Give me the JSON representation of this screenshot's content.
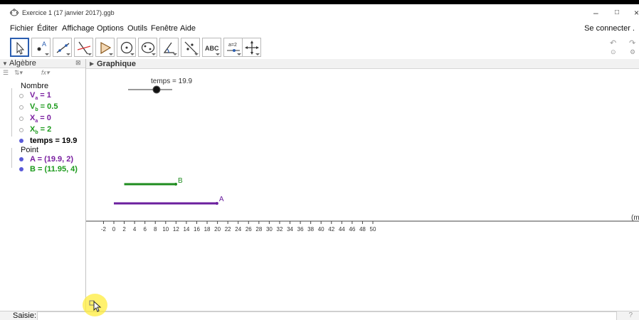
{
  "window": {
    "title": "Exercice 1 (17 janvier 2017).ggb",
    "minimize": "–",
    "maximize": "□",
    "close": "×"
  },
  "menu": {
    "items": [
      "Fichier",
      "Éditer",
      "Affichage",
      "Options",
      "Outils",
      "Fenêtre",
      "Aide"
    ],
    "connect": "Se connecter ."
  },
  "toolbar": {
    "tools": [
      "move-tool",
      "point-tool",
      "line-tool",
      "perpendicular-tool",
      "polygon-tool",
      "circle-tool",
      "conic-tool",
      "angle-tool",
      "reflect-tool",
      "text-tool",
      "slider-tool",
      "move-graphics-tool"
    ],
    "text_tool_label": "ABC",
    "slider_tool_label": "a=2",
    "undo": "↶",
    "redo": "↷"
  },
  "algebra": {
    "header": "Algèbre",
    "close": "⊠",
    "categories": {
      "number": "Nombre",
      "point": "Point"
    },
    "items": [
      {
        "name": "V",
        "sub": "a",
        "rest": " = 1",
        "color": "purple"
      },
      {
        "name": "V",
        "sub": "b",
        "rest": " = 0.5",
        "color": "green"
      },
      {
        "name": "X",
        "sub": "a",
        "rest": " = 0",
        "color": "purple"
      },
      {
        "name": "X",
        "sub": "b",
        "rest": " = 2",
        "color": "green"
      },
      {
        "text": "temps = 19.9",
        "color": "black"
      }
    ],
    "points": [
      {
        "text": "A = (19.9, 2)",
        "color": "purple"
      },
      {
        "text": "B = (11.95, 4)",
        "color": "green"
      }
    ]
  },
  "graphics": {
    "header": "Graphique",
    "slider": {
      "label": "temps = 19.9",
      "value": 19.9
    },
    "segment_a": {
      "label": "A",
      "from": 0,
      "to": 19.9,
      "color": "#6b1f9e"
    },
    "segment_b": {
      "label": "B",
      "from": 2,
      "to": 11.95,
      "color": "#1e8c1e"
    },
    "axis": {
      "ticks": [
        "-2",
        "0",
        "2",
        "4",
        "6",
        "8",
        "10",
        "12",
        "14",
        "16",
        "18",
        "20",
        "22",
        "24",
        "26",
        "28",
        "30",
        "32",
        "34",
        "36",
        "38",
        "40",
        "42",
        "44",
        "46",
        "48",
        "50"
      ],
      "unit_label": "(m"
    }
  },
  "input": {
    "label": "Saisie:",
    "value": "",
    "help": "?"
  }
}
